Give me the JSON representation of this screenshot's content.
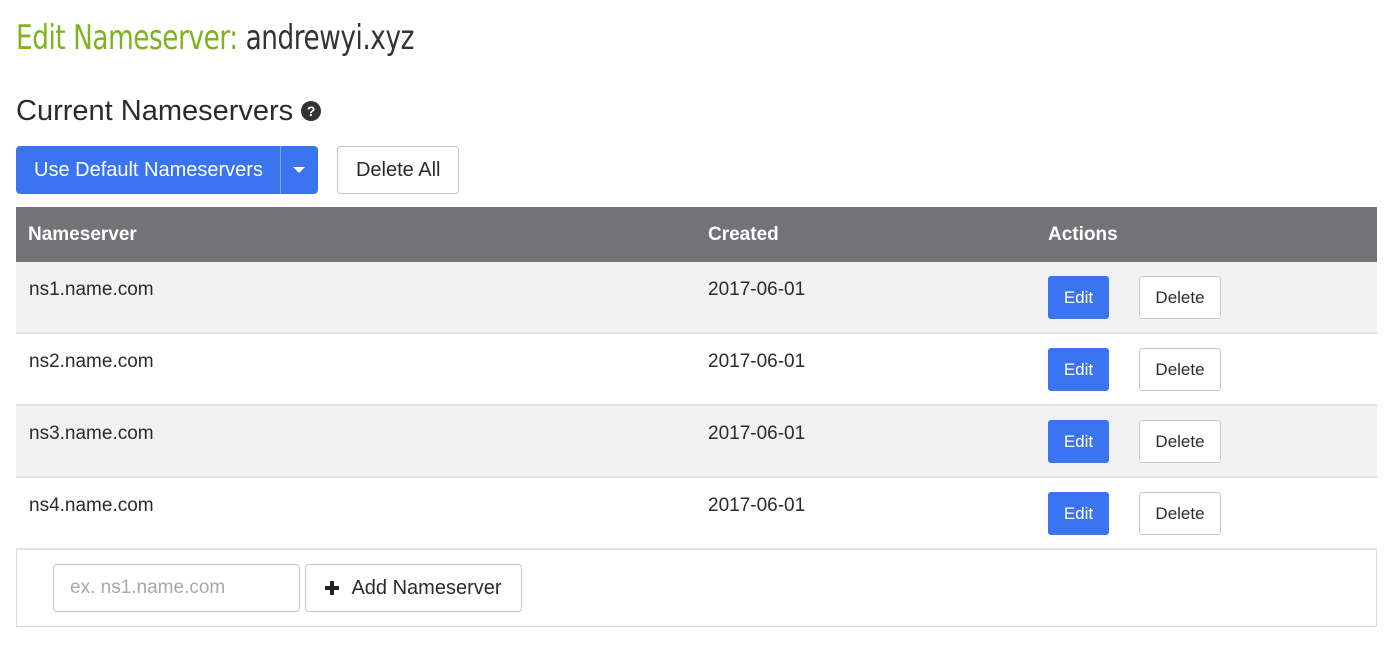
{
  "page": {
    "title_prefix": "Edit Nameserver:",
    "title_domain": "andrewyi.xyz"
  },
  "section": {
    "heading": "Current Nameservers",
    "help_icon": "question-circle-icon"
  },
  "toolbar": {
    "use_default_label": "Use Default Nameservers",
    "dropdown_icon": "caret-down-icon",
    "delete_all_label": "Delete All"
  },
  "table": {
    "columns": {
      "nameserver": "Nameserver",
      "created": "Created",
      "actions": "Actions"
    },
    "rows": [
      {
        "nameserver": "ns1.name.com",
        "created": "2017-06-01",
        "edit_label": "Edit",
        "delete_label": "Delete"
      },
      {
        "nameserver": "ns2.name.com",
        "created": "2017-06-01",
        "edit_label": "Edit",
        "delete_label": "Delete"
      },
      {
        "nameserver": "ns3.name.com",
        "created": "2017-06-01",
        "edit_label": "Edit",
        "delete_label": "Delete"
      },
      {
        "nameserver": "ns4.name.com",
        "created": "2017-06-01",
        "edit_label": "Edit",
        "delete_label": "Delete"
      }
    ]
  },
  "add_form": {
    "input_value": "",
    "input_placeholder": "ex. ns1.name.com",
    "add_icon": "plus-icon",
    "add_label": "Add Nameserver"
  },
  "colors": {
    "title_accent": "#7fb31d",
    "primary_button": "#3b74f0",
    "table_header": "#737377",
    "row_stripe": "#f2f2f2"
  }
}
